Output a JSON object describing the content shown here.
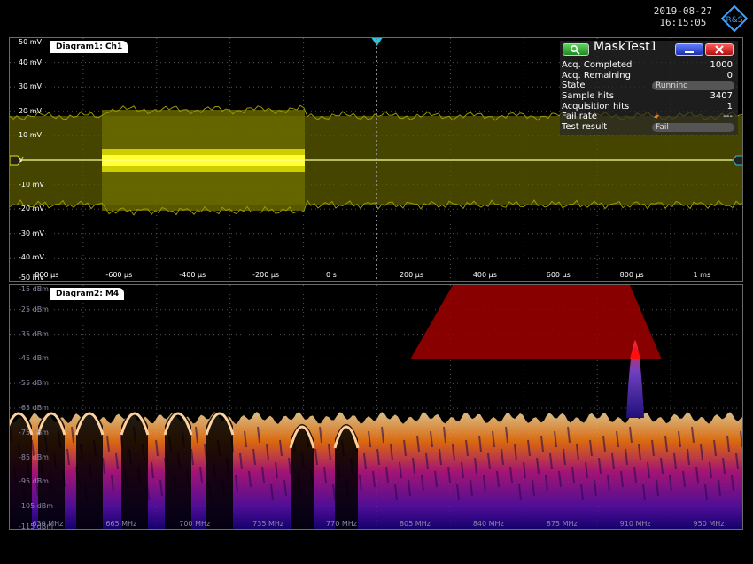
{
  "datetime": {
    "date": "2019-08-27",
    "time": "16:15:05"
  },
  "logo": {
    "text": "R&S"
  },
  "diagram1": {
    "label": "Diagram1: Ch1",
    "y_ticks": [
      "50 mV",
      "40 mV",
      "30 mV",
      "20 mV",
      "10 mV",
      "V",
      "-10 mV",
      "-20 mV",
      "-30 mV",
      "-40 mV",
      "-50 mV"
    ],
    "x_ticks": [
      "-800 µs",
      "-600 µs",
      "-400 µs",
      "-200 µs",
      "0 s",
      "200 µs",
      "400 µs",
      "600 µs",
      "800 µs",
      "1 ms"
    ],
    "channel_marker": "C1",
    "trigger_marker": "T",
    "trace_color": "#e6e600"
  },
  "diagram2": {
    "label": "Diagram2: M4",
    "y_ticks": [
      "-15 dBm",
      "-25 dBm",
      "-35 dBm",
      "-45 dBm",
      "-55 dBm",
      "-65 dBm",
      "-75 dBm",
      "-85 dBm",
      "-95 dBm",
      "-105 dBm",
      "-115 dBm"
    ],
    "x_ticks": [
      "630 MHz",
      "665 MHz",
      "700 MHz",
      "735 MHz",
      "770 MHz",
      "805 MHz",
      "840 MHz",
      "875 MHz",
      "910 MHz",
      "950 MHz"
    ],
    "mask_color": "#a00000"
  },
  "mask_test": {
    "title": "MaskTest1",
    "rows": [
      {
        "key": "Acq. Completed",
        "value": "1000"
      },
      {
        "key": "Acq. Remaining",
        "value": "0"
      },
      {
        "key": "State",
        "value": "Running"
      },
      {
        "key": "Sample hits",
        "value": "3407"
      },
      {
        "key": "Acquisition hits",
        "value": "1"
      },
      {
        "key": "Fail rate",
        "value": "---"
      },
      {
        "key": "Test result",
        "value": "Fail"
      }
    ],
    "icons": {
      "run": "magnifier-icon",
      "minimize": "minimize-icon",
      "close": "close-icon",
      "warning": "warning-icon"
    }
  }
}
